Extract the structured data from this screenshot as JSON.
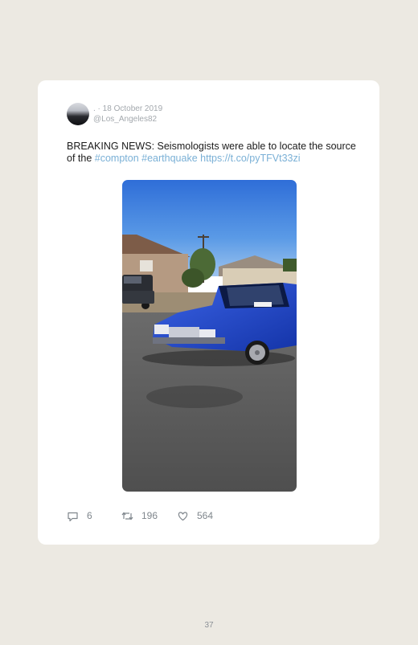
{
  "tweet": {
    "author_name": ".",
    "separator": " · ",
    "date": "18 October 2019",
    "handle": "@Los_Angeles82",
    "text_plain": "BREAKING NEWS: Seismologists were able to locate the source of the ",
    "hashtag1": "#compton",
    "hashtag2": "#earthquake",
    "link": "https://t.co/pyTFVt33zi",
    "media_description": "blue lowrider car on a street"
  },
  "actions": {
    "replies": "6",
    "retweets": "196",
    "likes": "564",
    "reply_icon": "reply-icon",
    "retweet_icon": "retweet-icon",
    "like_icon": "heart-icon"
  },
  "page": {
    "number": "37"
  },
  "colors": {
    "background": "#ece9e2",
    "card": "#ffffff",
    "link": "#7ab0d6",
    "meta": "#a3a8ad",
    "car_blue": "#1d3fc7"
  }
}
